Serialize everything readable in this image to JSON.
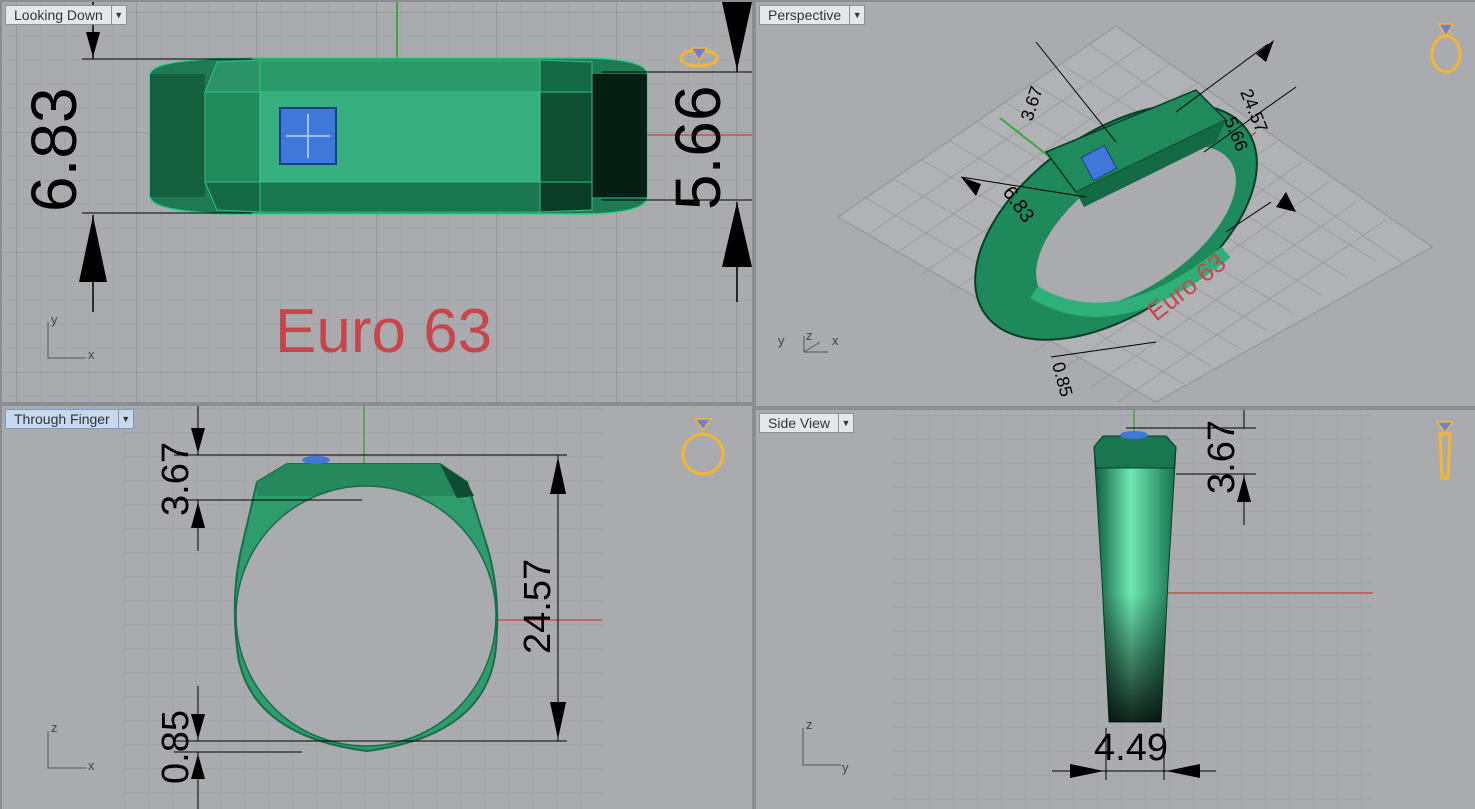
{
  "viewports": {
    "top": {
      "title": "Looking Down",
      "dims": {
        "height_left": "6.83",
        "height_right": "5.66"
      },
      "annotation": "Euro 63",
      "axes": {
        "vertical": "y",
        "horizontal": "x"
      }
    },
    "perspective": {
      "title": "Perspective",
      "dims": {
        "d1": "3.67",
        "d2": "24.57",
        "d3": "5.66",
        "d4": "6.83",
        "d5": "0.85"
      },
      "annotation": "Euro 63",
      "axes": {
        "a": "y",
        "b": "z",
        "c": "x"
      }
    },
    "front": {
      "title": "Through Finger",
      "dims": {
        "top": "3.67",
        "height": "24.57",
        "bottom": "0.85"
      },
      "axes": {
        "vertical": "z",
        "horizontal": "x"
      }
    },
    "side": {
      "title": "Side View",
      "dims": {
        "top": "3.67",
        "width": "4.49"
      },
      "axes": {
        "vertical": "z",
        "horizontal": "y"
      }
    }
  },
  "colors": {
    "ring_green": "#2e9c6c",
    "ring_dark": "#0e4d33",
    "gem_blue": "#3f78d8",
    "axis_red": "#c94e4e",
    "axis_green": "#3aa83a",
    "text_red": "#c8464b",
    "widget_gold": "#f2b632"
  },
  "icons": [
    "ring-navigation-widget-icon",
    "dropdown-arrow-icon"
  ]
}
